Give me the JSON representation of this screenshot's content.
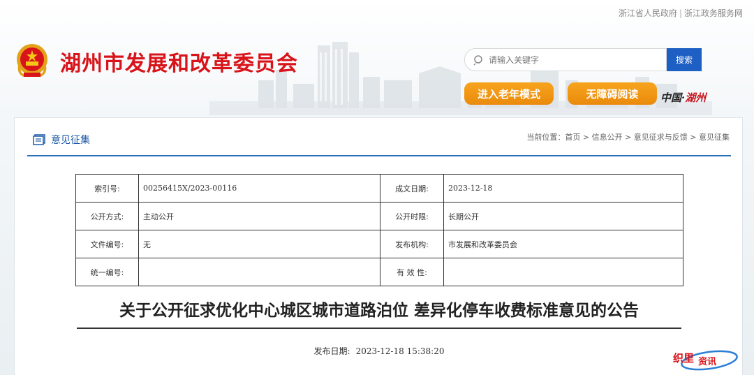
{
  "top_links": {
    "gov": "浙江省人民政府",
    "sep": "|",
    "service": "浙江政务服务网"
  },
  "header": {
    "site_title": "湖州市发展和改革委员会",
    "search_placeholder": "请输入关键字",
    "search_button": "搜索",
    "elder_mode": "进入老年模式",
    "accessible_read": "无障碍阅读",
    "china_prefix": "中国·",
    "china_city": "湖州"
  },
  "section": {
    "title": "意见征集",
    "breadcrumb": "当前位置：首页 > 信息公开 > 意见征求与反馈 > 意见征集"
  },
  "meta": {
    "rows": [
      {
        "l1": "索引号:",
        "v1": "00256415X/2023-00116",
        "l2": "成文日期:",
        "v2": "2023-12-18"
      },
      {
        "l1": "公开方式:",
        "v1": "主动公开",
        "l2": "公开时限:",
        "v2": "长期公开"
      },
      {
        "l1": "文件编号:",
        "v1": "无",
        "l2": "发布机构:",
        "v2": "市发展和改革委员会"
      },
      {
        "l1": "统一编号:",
        "v1": "",
        "l2": "有 效 性:",
        "v2": ""
      }
    ]
  },
  "document": {
    "title": "关于公开征求优化中心城区城市道路泊位 差异化停车收费标准意见的公告",
    "pub_label": "发布日期:",
    "pub_date": "2023-12-18 15:38:20"
  },
  "watermark": {
    "text": "织里资讯"
  },
  "colors": {
    "brand_red": "#d8141a",
    "accent_blue": "#1e5fc4",
    "pill_orange": "#f29a16"
  }
}
